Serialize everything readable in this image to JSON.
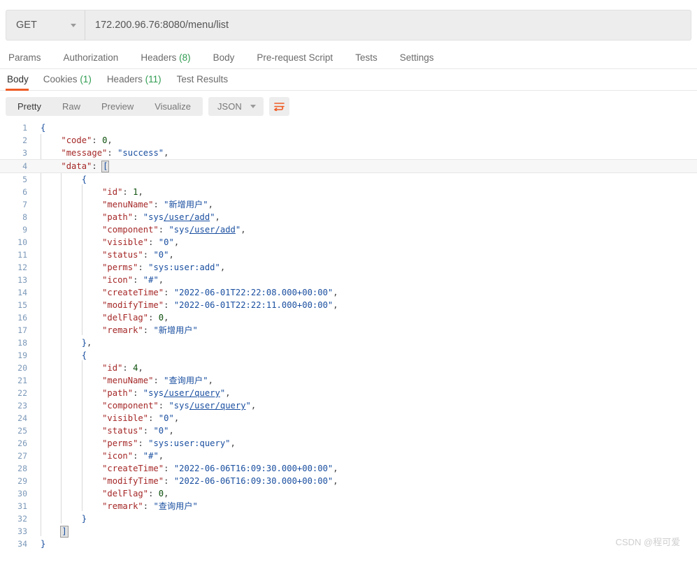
{
  "request": {
    "method": "GET",
    "url": "172.200.96.76:8080/menu/list",
    "tabs": [
      {
        "label": "Params",
        "count": ""
      },
      {
        "label": "Authorization",
        "count": ""
      },
      {
        "label": "Headers",
        "count": "(8)"
      },
      {
        "label": "Body",
        "count": ""
      },
      {
        "label": "Pre-request Script",
        "count": ""
      },
      {
        "label": "Tests",
        "count": ""
      },
      {
        "label": "Settings",
        "count": ""
      }
    ]
  },
  "response": {
    "tabs": [
      {
        "label": "Body",
        "count": "",
        "active": true
      },
      {
        "label": "Cookies",
        "count": "(1)",
        "active": false
      },
      {
        "label": "Headers",
        "count": "(11)",
        "active": false
      },
      {
        "label": "Test Results",
        "count": "",
        "active": false
      }
    ],
    "view_modes": [
      "Pretty",
      "Raw",
      "Preview",
      "Visualize"
    ],
    "active_view_mode": "Pretty",
    "format": "JSON",
    "wrap_icon": "word-wrap-icon",
    "accent_color": "#ef5b25",
    "count_color": "#2e9b4f"
  },
  "body_json": {
    "code": 0,
    "message": "success",
    "data": [
      {
        "id": 1,
        "menuName": "新增用户",
        "path": "sys/user/add",
        "component": "sys/user/add",
        "visible": "0",
        "status": "0",
        "perms": "sys:user:add",
        "icon": "#",
        "createTime": "2022-06-01T22:22:08.000+00:00",
        "modifyTime": "2022-06-01T22:22:11.000+00:00",
        "delFlag": 0,
        "remark": "新增用户"
      },
      {
        "id": 4,
        "menuName": "查询用户",
        "path": "sys/user/query",
        "component": "sys/user/query",
        "visible": "0",
        "status": "0",
        "perms": "sys:user:query",
        "icon": "#",
        "createTime": "2022-06-06T16:09:30.000+00:00",
        "modifyTime": "2022-06-06T16:09:30.000+00:00",
        "delFlag": 0,
        "remark": "查询用户"
      }
    ]
  },
  "editor": {
    "total_lines": 34,
    "highlighted_line": 4,
    "bracket_match_lines": [
      4,
      33
    ]
  },
  "watermark": "CSDN @程可爱"
}
